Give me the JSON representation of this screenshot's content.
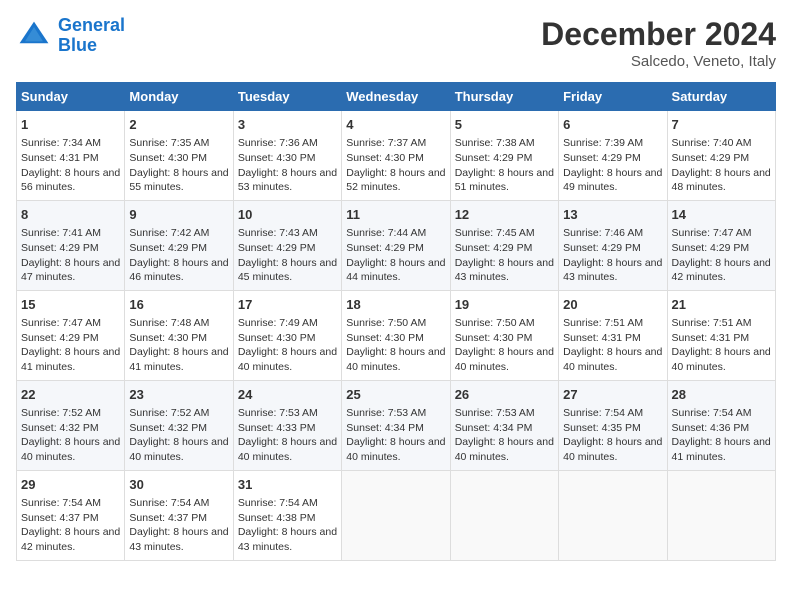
{
  "header": {
    "logo_line1": "General",
    "logo_line2": "Blue",
    "month": "December 2024",
    "location": "Salcedo, Veneto, Italy"
  },
  "weekdays": [
    "Sunday",
    "Monday",
    "Tuesday",
    "Wednesday",
    "Thursday",
    "Friday",
    "Saturday"
  ],
  "weeks": [
    [
      {
        "day": "1",
        "sunrise": "Sunrise: 7:34 AM",
        "sunset": "Sunset: 4:31 PM",
        "daylight": "Daylight: 8 hours and 56 minutes."
      },
      {
        "day": "2",
        "sunrise": "Sunrise: 7:35 AM",
        "sunset": "Sunset: 4:30 PM",
        "daylight": "Daylight: 8 hours and 55 minutes."
      },
      {
        "day": "3",
        "sunrise": "Sunrise: 7:36 AM",
        "sunset": "Sunset: 4:30 PM",
        "daylight": "Daylight: 8 hours and 53 minutes."
      },
      {
        "day": "4",
        "sunrise": "Sunrise: 7:37 AM",
        "sunset": "Sunset: 4:30 PM",
        "daylight": "Daylight: 8 hours and 52 minutes."
      },
      {
        "day": "5",
        "sunrise": "Sunrise: 7:38 AM",
        "sunset": "Sunset: 4:29 PM",
        "daylight": "Daylight: 8 hours and 51 minutes."
      },
      {
        "day": "6",
        "sunrise": "Sunrise: 7:39 AM",
        "sunset": "Sunset: 4:29 PM",
        "daylight": "Daylight: 8 hours and 49 minutes."
      },
      {
        "day": "7",
        "sunrise": "Sunrise: 7:40 AM",
        "sunset": "Sunset: 4:29 PM",
        "daylight": "Daylight: 8 hours and 48 minutes."
      }
    ],
    [
      {
        "day": "8",
        "sunrise": "Sunrise: 7:41 AM",
        "sunset": "Sunset: 4:29 PM",
        "daylight": "Daylight: 8 hours and 47 minutes."
      },
      {
        "day": "9",
        "sunrise": "Sunrise: 7:42 AM",
        "sunset": "Sunset: 4:29 PM",
        "daylight": "Daylight: 8 hours and 46 minutes."
      },
      {
        "day": "10",
        "sunrise": "Sunrise: 7:43 AM",
        "sunset": "Sunset: 4:29 PM",
        "daylight": "Daylight: 8 hours and 45 minutes."
      },
      {
        "day": "11",
        "sunrise": "Sunrise: 7:44 AM",
        "sunset": "Sunset: 4:29 PM",
        "daylight": "Daylight: 8 hours and 44 minutes."
      },
      {
        "day": "12",
        "sunrise": "Sunrise: 7:45 AM",
        "sunset": "Sunset: 4:29 PM",
        "daylight": "Daylight: 8 hours and 43 minutes."
      },
      {
        "day": "13",
        "sunrise": "Sunrise: 7:46 AM",
        "sunset": "Sunset: 4:29 PM",
        "daylight": "Daylight: 8 hours and 43 minutes."
      },
      {
        "day": "14",
        "sunrise": "Sunrise: 7:47 AM",
        "sunset": "Sunset: 4:29 PM",
        "daylight": "Daylight: 8 hours and 42 minutes."
      }
    ],
    [
      {
        "day": "15",
        "sunrise": "Sunrise: 7:47 AM",
        "sunset": "Sunset: 4:29 PM",
        "daylight": "Daylight: 8 hours and 41 minutes."
      },
      {
        "day": "16",
        "sunrise": "Sunrise: 7:48 AM",
        "sunset": "Sunset: 4:30 PM",
        "daylight": "Daylight: 8 hours and 41 minutes."
      },
      {
        "day": "17",
        "sunrise": "Sunrise: 7:49 AM",
        "sunset": "Sunset: 4:30 PM",
        "daylight": "Daylight: 8 hours and 40 minutes."
      },
      {
        "day": "18",
        "sunrise": "Sunrise: 7:50 AM",
        "sunset": "Sunset: 4:30 PM",
        "daylight": "Daylight: 8 hours and 40 minutes."
      },
      {
        "day": "19",
        "sunrise": "Sunrise: 7:50 AM",
        "sunset": "Sunset: 4:30 PM",
        "daylight": "Daylight: 8 hours and 40 minutes."
      },
      {
        "day": "20",
        "sunrise": "Sunrise: 7:51 AM",
        "sunset": "Sunset: 4:31 PM",
        "daylight": "Daylight: 8 hours and 40 minutes."
      },
      {
        "day": "21",
        "sunrise": "Sunrise: 7:51 AM",
        "sunset": "Sunset: 4:31 PM",
        "daylight": "Daylight: 8 hours and 40 minutes."
      }
    ],
    [
      {
        "day": "22",
        "sunrise": "Sunrise: 7:52 AM",
        "sunset": "Sunset: 4:32 PM",
        "daylight": "Daylight: 8 hours and 40 minutes."
      },
      {
        "day": "23",
        "sunrise": "Sunrise: 7:52 AM",
        "sunset": "Sunset: 4:32 PM",
        "daylight": "Daylight: 8 hours and 40 minutes."
      },
      {
        "day": "24",
        "sunrise": "Sunrise: 7:53 AM",
        "sunset": "Sunset: 4:33 PM",
        "daylight": "Daylight: 8 hours and 40 minutes."
      },
      {
        "day": "25",
        "sunrise": "Sunrise: 7:53 AM",
        "sunset": "Sunset: 4:34 PM",
        "daylight": "Daylight: 8 hours and 40 minutes."
      },
      {
        "day": "26",
        "sunrise": "Sunrise: 7:53 AM",
        "sunset": "Sunset: 4:34 PM",
        "daylight": "Daylight: 8 hours and 40 minutes."
      },
      {
        "day": "27",
        "sunrise": "Sunrise: 7:54 AM",
        "sunset": "Sunset: 4:35 PM",
        "daylight": "Daylight: 8 hours and 40 minutes."
      },
      {
        "day": "28",
        "sunrise": "Sunrise: 7:54 AM",
        "sunset": "Sunset: 4:36 PM",
        "daylight": "Daylight: 8 hours and 41 minutes."
      }
    ],
    [
      {
        "day": "29",
        "sunrise": "Sunrise: 7:54 AM",
        "sunset": "Sunset: 4:37 PM",
        "daylight": "Daylight: 8 hours and 42 minutes."
      },
      {
        "day": "30",
        "sunrise": "Sunrise: 7:54 AM",
        "sunset": "Sunset: 4:37 PM",
        "daylight": "Daylight: 8 hours and 43 minutes."
      },
      {
        "day": "31",
        "sunrise": "Sunrise: 7:54 AM",
        "sunset": "Sunset: 4:38 PM",
        "daylight": "Daylight: 8 hours and 43 minutes."
      },
      null,
      null,
      null,
      null
    ]
  ]
}
